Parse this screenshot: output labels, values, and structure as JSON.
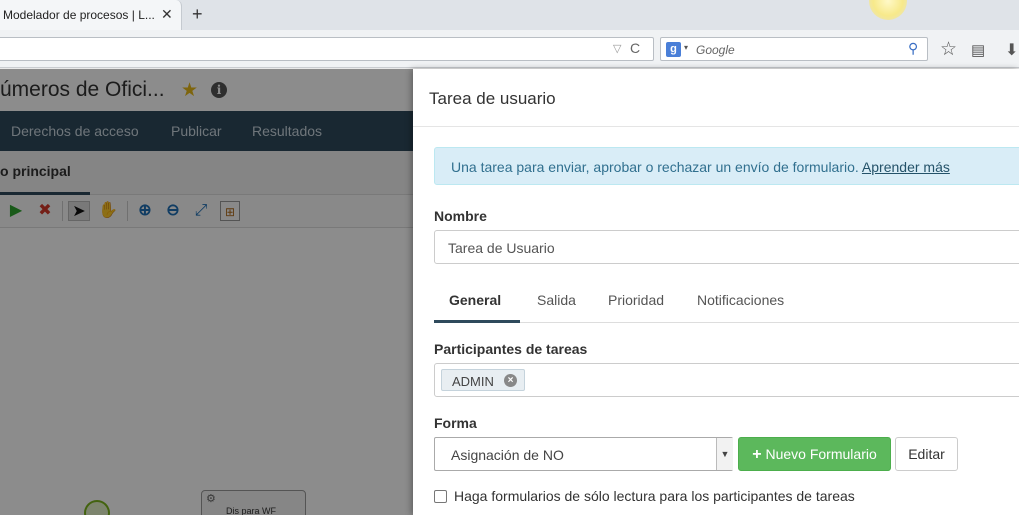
{
  "browser": {
    "tab_title": "Modelador de procesos | L...",
    "tab_close": "✕",
    "new_tab": "+",
    "url_dropdown": "▽",
    "url_reload": "C",
    "search_engine_letter": "g",
    "search_caret": "▾",
    "search_placeholder": "Google"
  },
  "app": {
    "title": "úmeros de Ofici...",
    "nav": [
      "Derechos de acceso",
      "Publicar",
      "Resultados"
    ],
    "subtab_active": "o principal",
    "task_node_label": "Dis para WF"
  },
  "panel": {
    "title": "Tarea de usuario",
    "alert_text": "Una tarea para enviar, aprobar o rechazar un envío de formulario.",
    "alert_link": "Aprender más",
    "nombre_label": "Nombre",
    "nombre_value": "Tarea de Usuario",
    "tabs": [
      "General",
      "Salida",
      "Prioridad",
      "Notificaciones"
    ],
    "participants_label": "Participantes de tareas",
    "participant_chip": "ADMIN",
    "forma_label": "Forma",
    "forma_value": "Asignación de NO",
    "new_form_button": "Nuevo Formulario",
    "edit_button": "Editar",
    "readonly_checkbox_label": "Haga formularios de sólo lectura para los participantes de tareas"
  },
  "colors": {
    "nav_bg": "#2f4a5c",
    "alert_bg": "#d9edf7",
    "alert_text": "#31708f",
    "primary_green": "#5cb85c",
    "star": "#e6b818"
  }
}
